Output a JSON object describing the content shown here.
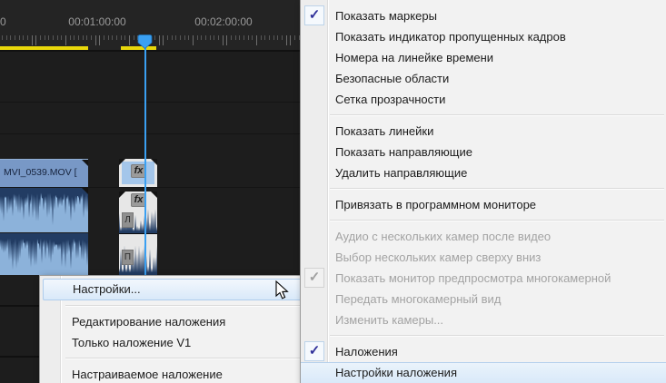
{
  "timeline": {
    "ruler": {
      "clipped_label": "0",
      "marks": [
        "00:01:00:00",
        "00:02:00:00"
      ]
    },
    "video_clip_label": "MVI_0539.MOV [",
    "fx_badge": "fx",
    "audio_channel_left": "Л",
    "audio_channel_right": "П",
    "colors": {
      "render_bar_yellow": "#e8d70a",
      "playhead_blue": "#3aa0f2",
      "clip_blue": "#7898c6",
      "audio_clip_blue": "#8cb2da",
      "waveform_navy": "#223c63"
    }
  },
  "left_menu": {
    "items": [
      {
        "label": "Настройки...",
        "highlighted": true
      },
      {
        "type": "separator"
      },
      {
        "label": "Редактирование наложения"
      },
      {
        "label": "Только наложение V1"
      },
      {
        "type": "separator"
      },
      {
        "label": "Настраиваемое наложение"
      }
    ]
  },
  "right_menu": {
    "items": [
      {
        "label": "Показать маркеры",
        "checked": true
      },
      {
        "label": "Показать индикатор пропущенных кадров"
      },
      {
        "label": "Номера на линейке времени"
      },
      {
        "label": "Безопасные области"
      },
      {
        "label": "Сетка прозрачности"
      },
      {
        "type": "separator"
      },
      {
        "label": "Показать линейки"
      },
      {
        "label": "Показать направляющие"
      },
      {
        "label": "Удалить направляющие"
      },
      {
        "type": "separator"
      },
      {
        "label": "Привязать в программном мониторе"
      },
      {
        "type": "separator"
      },
      {
        "label": "Аудио с нескольких камер после видео",
        "disabled": true
      },
      {
        "label": "Выбор нескольких камер сверху вниз",
        "disabled": true
      },
      {
        "label": "Показать монитор предпросмотра многокамерной",
        "disabled": true,
        "checked": true
      },
      {
        "label": "Передать многокамерный вид",
        "disabled": true
      },
      {
        "label": "Изменить камеры...",
        "disabled": true
      },
      {
        "type": "separator"
      },
      {
        "label": "Наложения",
        "checked": true
      },
      {
        "label": "Настройки наложения",
        "highlighted": true
      }
    ]
  }
}
